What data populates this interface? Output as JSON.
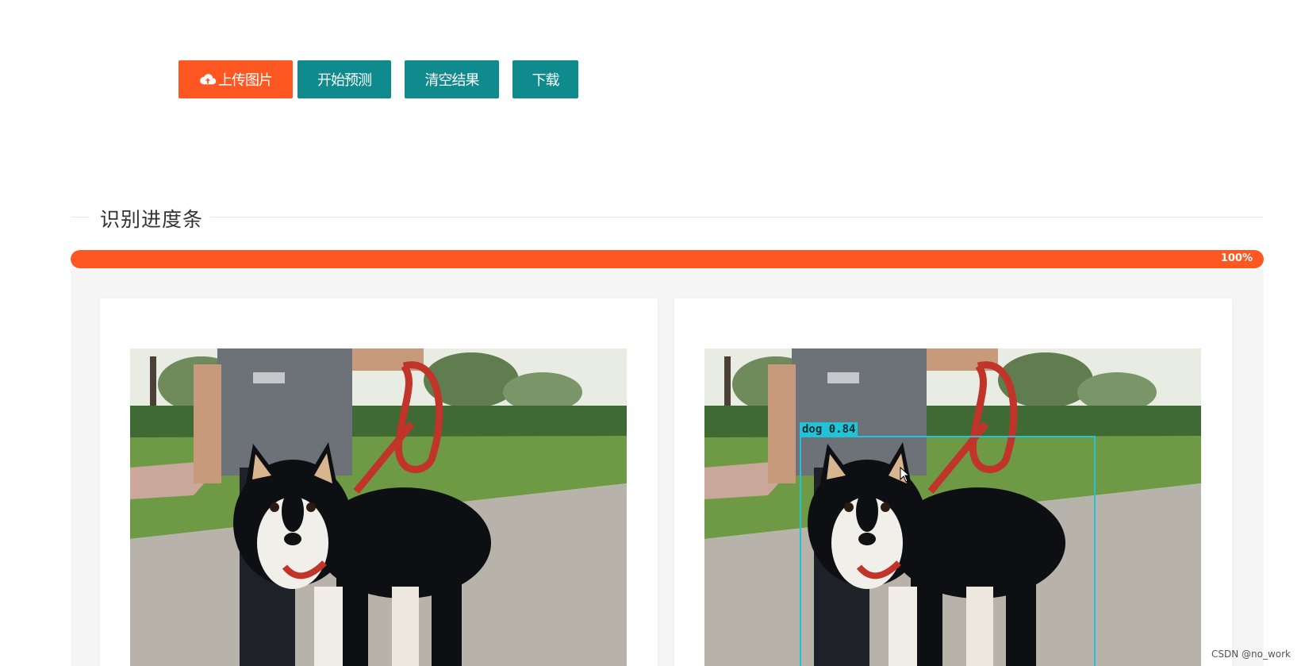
{
  "toolbar": {
    "upload_label": "上传图片",
    "predict_label": "开始预测",
    "clear_label": "清空结果",
    "download_label": "下载",
    "upload_icon": "cloud-upload-icon"
  },
  "colors": {
    "accent_orange": "#ff5722",
    "button_teal": "#0f8a8d",
    "detection_box": "#22c3d6"
  },
  "progress_section": {
    "title": "识别进度条",
    "percent": 100,
    "percent_label": "100%"
  },
  "results": {
    "original_image": "dog-with-leash-photo",
    "predicted_image": "dog-with-leash-photo-annotated",
    "detection": {
      "label": "dog  0.84",
      "class": "dog",
      "confidence": 0.84
    }
  },
  "watermark": "CSDN @no_work"
}
